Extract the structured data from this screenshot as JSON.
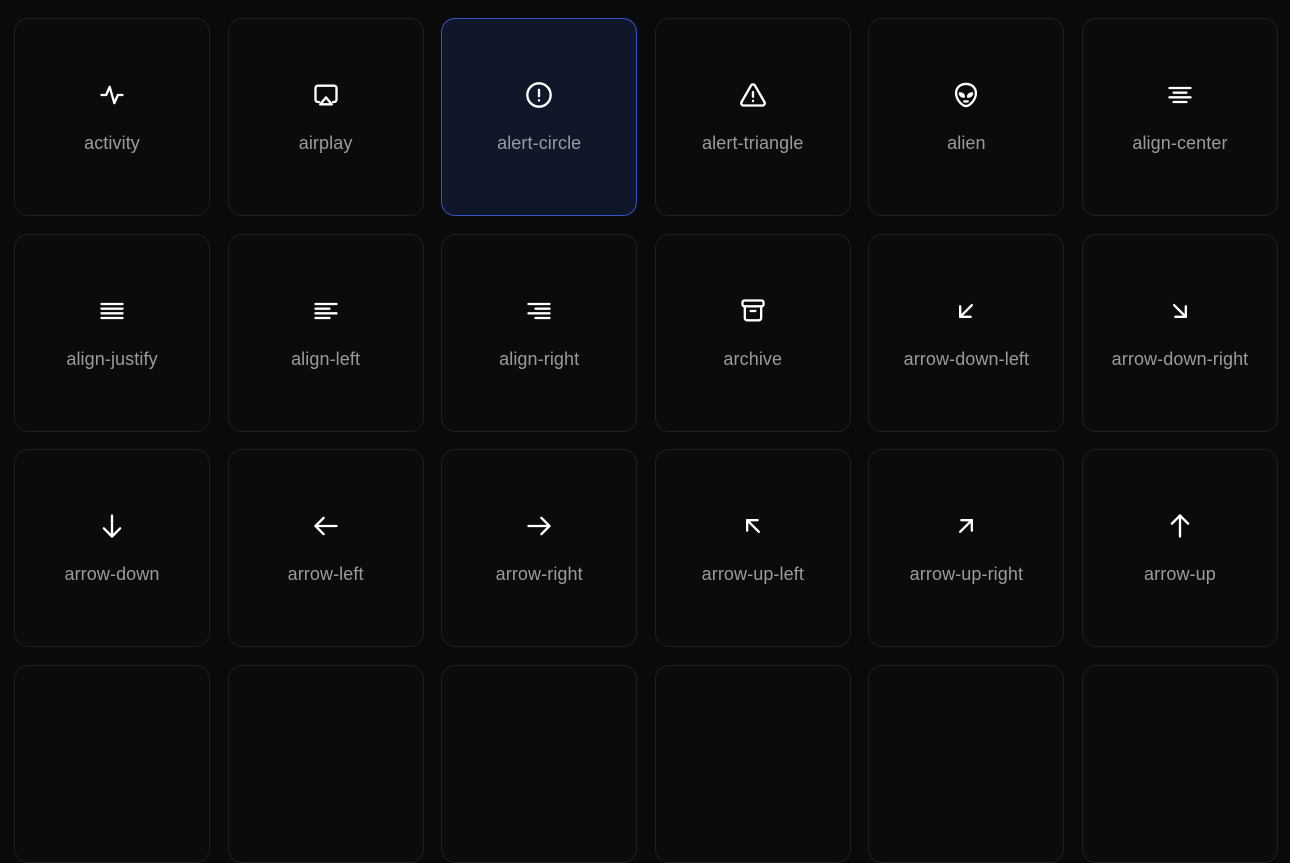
{
  "colors": {
    "background": "#0a0a0a",
    "tile_background": "#0b0b0c",
    "tile_border": "#1f1f22",
    "selected_background": "#101729",
    "selected_border": "#3553c9",
    "label": "#9a9aa0",
    "icon": "#ffffff"
  },
  "selected_index": 2,
  "icons": [
    {
      "label": "activity",
      "icon": "activity-icon"
    },
    {
      "label": "airplay",
      "icon": "airplay-icon"
    },
    {
      "label": "alert-circle",
      "icon": "alert-circle-icon"
    },
    {
      "label": "alert-triangle",
      "icon": "alert-triangle-icon"
    },
    {
      "label": "alien",
      "icon": "alien-icon"
    },
    {
      "label": "align-center",
      "icon": "align-center-icon"
    },
    {
      "label": "align-justify",
      "icon": "align-justify-icon"
    },
    {
      "label": "align-left",
      "icon": "align-left-icon"
    },
    {
      "label": "align-right",
      "icon": "align-right-icon"
    },
    {
      "label": "archive",
      "icon": "archive-icon"
    },
    {
      "label": "arrow-down-left",
      "icon": "arrow-down-left-icon"
    },
    {
      "label": "arrow-down-right",
      "icon": "arrow-down-right-icon"
    },
    {
      "label": "arrow-down",
      "icon": "arrow-down-icon"
    },
    {
      "label": "arrow-left",
      "icon": "arrow-left-icon"
    },
    {
      "label": "arrow-right",
      "icon": "arrow-right-icon"
    },
    {
      "label": "arrow-up-left",
      "icon": "arrow-up-left-icon"
    },
    {
      "label": "arrow-up-right",
      "icon": "arrow-up-right-icon"
    },
    {
      "label": "arrow-up",
      "icon": "arrow-up-icon"
    },
    {
      "label": "",
      "icon": ""
    },
    {
      "label": "",
      "icon": ""
    },
    {
      "label": "",
      "icon": ""
    },
    {
      "label": "",
      "icon": ""
    },
    {
      "label": "",
      "icon": ""
    },
    {
      "label": "",
      "icon": ""
    }
  ]
}
